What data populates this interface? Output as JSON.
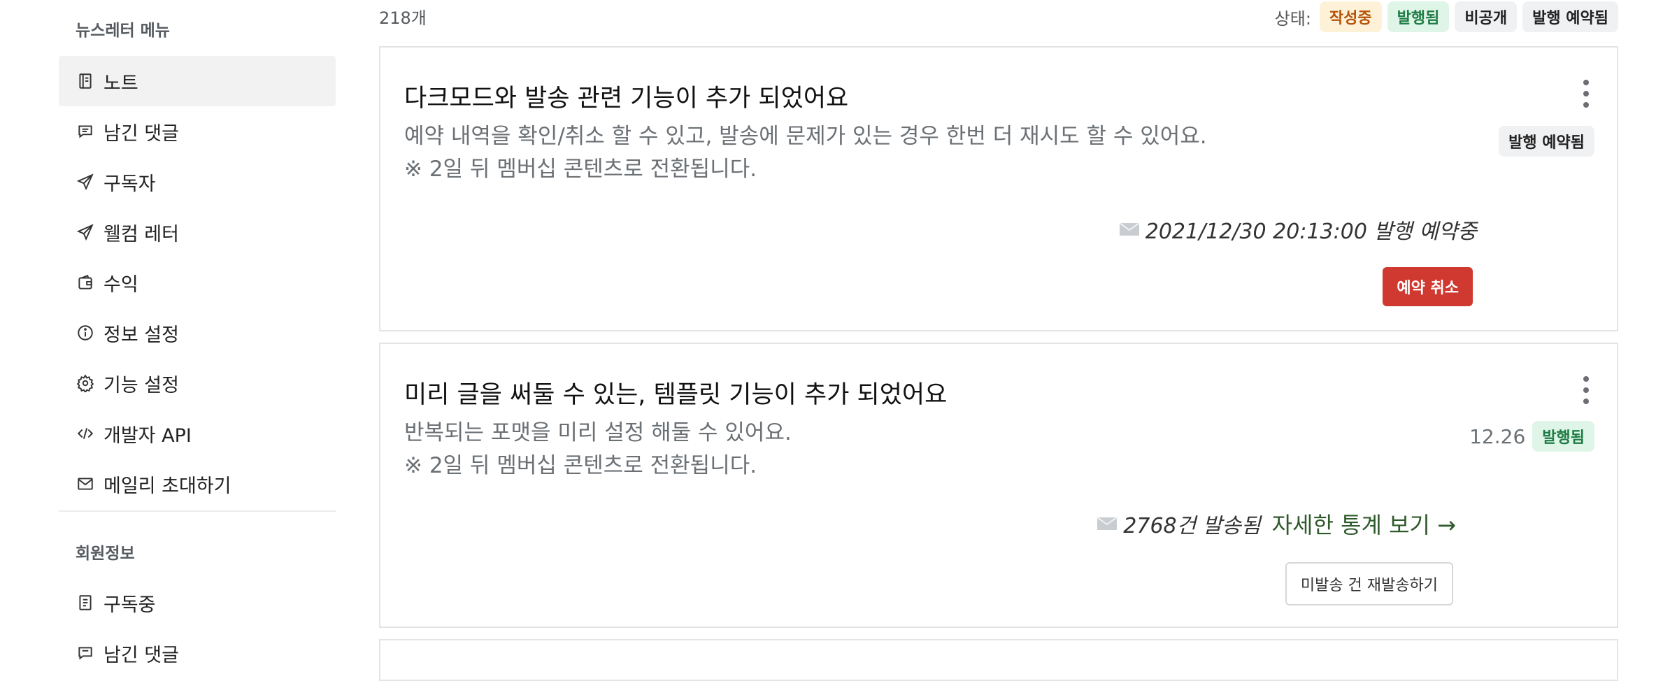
{
  "sidebar": {
    "newsletter_menu_title": "뉴스레터 메뉴",
    "items": [
      {
        "label": "노트",
        "icon": "notebook-icon"
      },
      {
        "label": "남긴 댓글",
        "icon": "comment-icon"
      },
      {
        "label": "구독자",
        "icon": "send-icon"
      },
      {
        "label": "웰컴 레터",
        "icon": "send-icon"
      },
      {
        "label": "수익",
        "icon": "wallet-icon"
      },
      {
        "label": "정보 설정",
        "icon": "info-icon"
      },
      {
        "label": "기능 설정",
        "icon": "gear-icon"
      },
      {
        "label": "개발자 API",
        "icon": "code-icon"
      },
      {
        "label": "메일리 초대하기",
        "icon": "mail-icon"
      }
    ],
    "member_title": "회원정보",
    "member_items": [
      {
        "label": "구독중",
        "icon": "list-icon"
      },
      {
        "label": "남긴 댓글",
        "icon": "comment-icon"
      }
    ]
  },
  "main": {
    "count": "218개",
    "status_label": "상태:",
    "status_badges": [
      "작성중",
      "발행됨",
      "비공개",
      "발행 예약됨"
    ],
    "posts": [
      {
        "title": "다크모드와 발송 관련 기능이 추가 되었어요",
        "desc_line1": "예약 내역을 확인/취소 할 수 있고, 발송에 문제가 있는 경우 한번 더 재시도 할 수 있어요.",
        "desc_line2": "※ 2일 뒤 멤버십 콘텐츠로 전환됩니다.",
        "badge": "발행 예약됨",
        "info": "2021/12/30 20:13:00 발행 예약중",
        "action": "예약 취소"
      },
      {
        "title": "미리 글을 써둘 수 있는, 템플릿 기능이 추가 되었어요",
        "desc_line1": "반복되는 포맷을 미리 설정 해둘 수 있어요.",
        "desc_line2": "※ 2일 뒤 멤버십 콘텐츠로 전환됩니다.",
        "date": "12.26",
        "badge": "발행됨",
        "info": "2768건 발송됨",
        "stats_link": "자세한 통계 보기 →",
        "action": "미발송 건 재발송하기"
      }
    ]
  },
  "colors": {
    "accent_red": "#d0392f",
    "published_green": "#1e7c43",
    "draft_orange": "#b45309"
  }
}
